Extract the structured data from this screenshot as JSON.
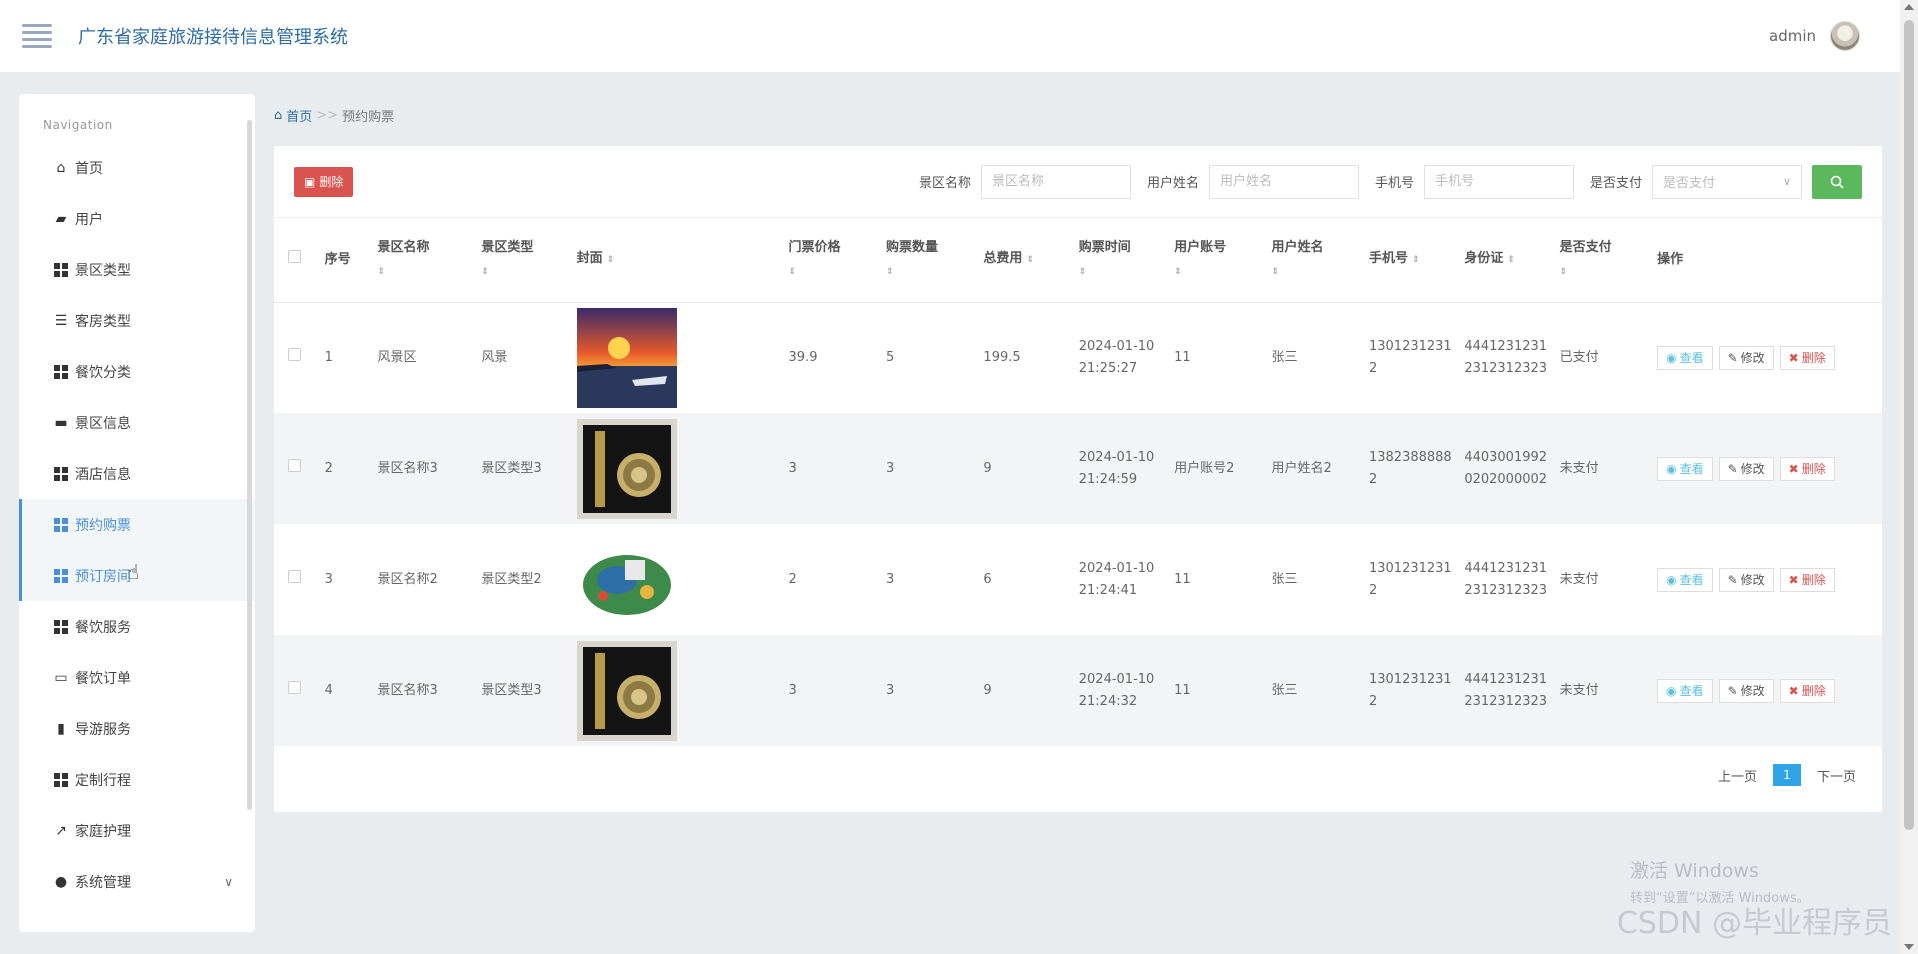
{
  "header": {
    "title": "广东省家庭旅游接待信息管理系统",
    "user": "admin"
  },
  "sidebar": {
    "heading": "Navigation",
    "items": [
      {
        "label": "首页",
        "icon": "home-icon"
      },
      {
        "label": "用户",
        "icon": "wallet-icon"
      },
      {
        "label": "景区类型",
        "icon": "grid-icon"
      },
      {
        "label": "客房类型",
        "icon": "list-icon"
      },
      {
        "label": "餐饮分类",
        "icon": "grid-icon"
      },
      {
        "label": "景区信息",
        "icon": "comment-icon"
      },
      {
        "label": "酒店信息",
        "icon": "grid-icon"
      },
      {
        "label": "预约购票",
        "icon": "grid-icon"
      },
      {
        "label": "预订房间",
        "icon": "grid-icon"
      },
      {
        "label": "餐饮服务",
        "icon": "grid-icon"
      },
      {
        "label": "餐饮订单",
        "icon": "desktop-icon"
      },
      {
        "label": "导游服务",
        "icon": "book-icon"
      },
      {
        "label": "定制行程",
        "icon": "grid-icon"
      },
      {
        "label": "家庭护理",
        "icon": "chart-icon"
      },
      {
        "label": "系统管理",
        "icon": "user-icon"
      }
    ]
  },
  "breadcrumb": {
    "home": "首页",
    "separator": ">>",
    "current": "预约购票"
  },
  "toolbar": {
    "delete_label": "删除",
    "filters": [
      {
        "label": "景区名称",
        "placeholder": "景区名称"
      },
      {
        "label": "用户姓名",
        "placeholder": "用户姓名"
      },
      {
        "label": "手机号",
        "placeholder": "手机号"
      }
    ],
    "pay_label": "是否支付",
    "pay_placeholder": "是否支付"
  },
  "table": {
    "columns": [
      "序号",
      "景区名称",
      "景区类型",
      "封面",
      "门票价格",
      "购票数量",
      "总费用",
      "购票时间",
      "用户账号",
      "用户姓名",
      "手机号",
      "身份证",
      "是否支付",
      "操作"
    ],
    "rows": [
      {
        "no": "1",
        "scenic_name": "风景区",
        "scenic_type": "风景",
        "cover": "sunset",
        "price": "39.9",
        "qty": "5",
        "total": "199.5",
        "time": "2024-01-10 21:25:27",
        "account": "11",
        "name": "张三",
        "phone": "13012312312",
        "id_card": "44412312312312312323",
        "paid": "已支付"
      },
      {
        "no": "2",
        "scenic_name": "景区名称3",
        "scenic_type": "景区类型3",
        "cover": "giftbox",
        "price": "3",
        "qty": "3",
        "total": "9",
        "time": "2024-01-10 21:24:59",
        "account": "用户账号2",
        "name": "用户姓名2",
        "phone": "13823888882",
        "id_card": "44030019920202000002",
        "paid": "未支付"
      },
      {
        "no": "3",
        "scenic_name": "景区名称2",
        "scenic_type": "景区类型2",
        "cover": "magnet",
        "price": "2",
        "qty": "3",
        "total": "6",
        "time": "2024-01-10 21:24:41",
        "account": "11",
        "name": "张三",
        "phone": "13012312312",
        "id_card": "44412312312312312323",
        "paid": "未支付"
      },
      {
        "no": "4",
        "scenic_name": "景区名称3",
        "scenic_type": "景区类型3",
        "cover": "giftbox",
        "price": "3",
        "qty": "3",
        "total": "9",
        "time": "2024-01-10 21:24:32",
        "account": "11",
        "name": "张三",
        "phone": "13012312312",
        "id_card": "44412312312312312323",
        "paid": "未支付"
      }
    ],
    "actions": {
      "view": "查看",
      "edit": "修改",
      "delete": "删除"
    }
  },
  "pager": {
    "prev": "上一页",
    "current": "1",
    "next": "下一页"
  },
  "watermark": {
    "line1": "激活 Windows",
    "line2": "转到“设置”以激活 Windows。",
    "csdn": "CSDN @毕业程序员"
  },
  "colors": {
    "accent": "#2d6ca2",
    "danger": "#d9534f",
    "success": "#5cb85c",
    "info": "#5bc0de",
    "page": "#2fa4e7"
  }
}
